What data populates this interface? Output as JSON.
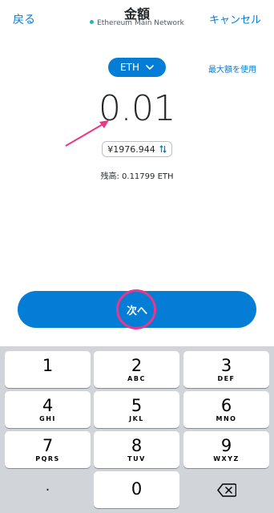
{
  "header": {
    "back_label": "戻る",
    "title": "金額",
    "network": "Ethereum Main Network",
    "cancel_label": "キャンセル"
  },
  "currency": {
    "selected": "ETH",
    "icon": "chevron-down-icon"
  },
  "max_label": "最大額を使用",
  "amount": "0.01",
  "fiat_value": "¥1976.944",
  "balance": "残高: 0.11799 ETH",
  "next_label": "次へ",
  "keypad": {
    "keys": [
      {
        "num": "1",
        "letters": ""
      },
      {
        "num": "2",
        "letters": "ABC"
      },
      {
        "num": "3",
        "letters": "DEF"
      },
      {
        "num": "4",
        "letters": "GHI"
      },
      {
        "num": "5",
        "letters": "JKL"
      },
      {
        "num": "6",
        "letters": "MNO"
      },
      {
        "num": "7",
        "letters": "PQRS"
      },
      {
        "num": "8",
        "letters": "TUV"
      },
      {
        "num": "9",
        "letters": "WXYZ"
      },
      {
        "num": "."
      },
      {
        "num": "0"
      }
    ]
  },
  "colors": {
    "accent": "#037dd6",
    "annotation": "#e8388a",
    "keypad_bg": "#d1d4d9"
  }
}
